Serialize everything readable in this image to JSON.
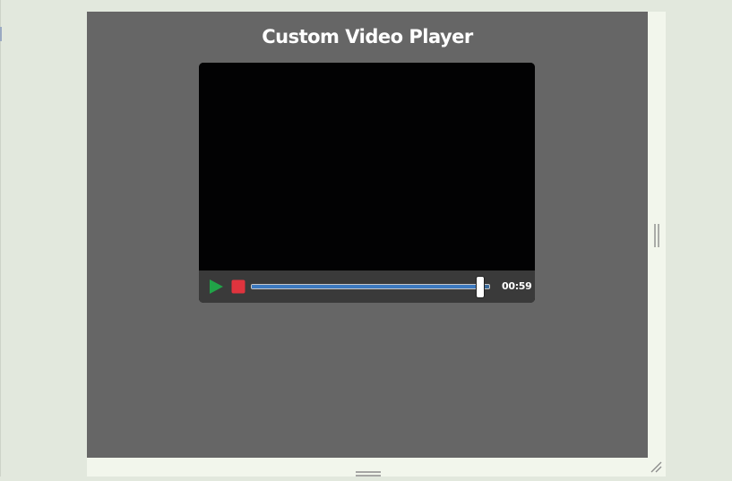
{
  "page": {
    "title": "Custom Video Player"
  },
  "player": {
    "play_icon": "play-icon",
    "stop_icon": "stop-icon",
    "progress_fraction": 0.97,
    "time": "00:59"
  },
  "colors": {
    "stage": "#666666",
    "video": "#020203",
    "controls": "#3a3a3a",
    "play": "#21a348",
    "stop": "#e0343e",
    "seek": "#3d7ac0"
  },
  "window": {
    "vertical_handle_icon": "resize-handle-vertical-icon",
    "horizontal_handle_icon": "resize-handle-horizontal-icon",
    "corner_grip_icon": "resize-grip-icon"
  }
}
